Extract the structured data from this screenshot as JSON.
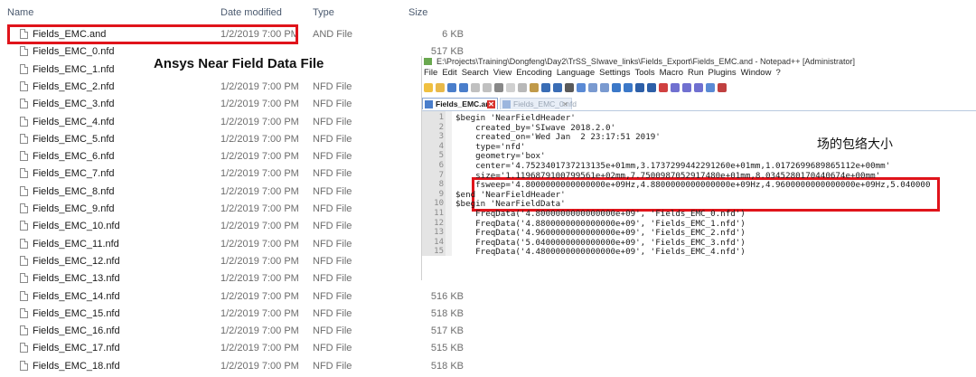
{
  "explorer": {
    "columns": {
      "name": "Name",
      "date": "Date modified",
      "type": "Type",
      "size": "Size"
    },
    "files": [
      {
        "name": "Fields_EMC.and",
        "date": "1/2/2019 7:00 PM",
        "type": "AND File",
        "size": "6 KB"
      },
      {
        "name": "Fields_EMC_0.nfd",
        "date": "",
        "type": "",
        "size": "517 KB"
      },
      {
        "name": "Fields_EMC_1.nfd",
        "date": "",
        "type": "",
        "size": ""
      },
      {
        "name": "Fields_EMC_2.nfd",
        "date": "1/2/2019 7:00 PM",
        "type": "NFD File",
        "size": ""
      },
      {
        "name": "Fields_EMC_3.nfd",
        "date": "1/2/2019 7:00 PM",
        "type": "NFD File",
        "size": ""
      },
      {
        "name": "Fields_EMC_4.nfd",
        "date": "1/2/2019 7:00 PM",
        "type": "NFD File",
        "size": ""
      },
      {
        "name": "Fields_EMC_5.nfd",
        "date": "1/2/2019 7:00 PM",
        "type": "NFD File",
        "size": ""
      },
      {
        "name": "Fields_EMC_6.nfd",
        "date": "1/2/2019 7:00 PM",
        "type": "NFD File",
        "size": ""
      },
      {
        "name": "Fields_EMC_7.nfd",
        "date": "1/2/2019 7:00 PM",
        "type": "NFD File",
        "size": ""
      },
      {
        "name": "Fields_EMC_8.nfd",
        "date": "1/2/2019 7:00 PM",
        "type": "NFD File",
        "size": ""
      },
      {
        "name": "Fields_EMC_9.nfd",
        "date": "1/2/2019 7:00 PM",
        "type": "NFD File",
        "size": ""
      },
      {
        "name": "Fields_EMC_10.nfd",
        "date": "1/2/2019 7:00 PM",
        "type": "NFD File",
        "size": ""
      },
      {
        "name": "Fields_EMC_11.nfd",
        "date": "1/2/2019 7:00 PM",
        "type": "NFD File",
        "size": ""
      },
      {
        "name": "Fields_EMC_12.nfd",
        "date": "1/2/2019 7:00 PM",
        "type": "NFD File",
        "size": ""
      },
      {
        "name": "Fields_EMC_13.nfd",
        "date": "1/2/2019 7:00 PM",
        "type": "NFD File",
        "size": ""
      },
      {
        "name": "Fields_EMC_14.nfd",
        "date": "1/2/2019 7:00 PM",
        "type": "NFD File",
        "size": "516 KB"
      },
      {
        "name": "Fields_EMC_15.nfd",
        "date": "1/2/2019 7:00 PM",
        "type": "NFD File",
        "size": "518 KB"
      },
      {
        "name": "Fields_EMC_16.nfd",
        "date": "1/2/2019 7:00 PM",
        "type": "NFD File",
        "size": "517 KB"
      },
      {
        "name": "Fields_EMC_17.nfd",
        "date": "1/2/2019 7:00 PM",
        "type": "NFD File",
        "size": "515 KB"
      },
      {
        "name": "Fields_EMC_18.nfd",
        "date": "1/2/2019 7:00 PM",
        "type": "NFD File",
        "size": "518 KB"
      }
    ]
  },
  "annotation_file": "Ansys Near Field Data File",
  "annotation_size": "场的包络大小",
  "notepad": {
    "title": "E:\\Projects\\Training\\Dongfeng\\Day2\\TrSS_SIwave_links\\Fields_Export\\Fields_EMC.and - Notepad++ [Administrator]",
    "menu": [
      "File",
      "Edit",
      "Search",
      "View",
      "Encoding",
      "Language",
      "Settings",
      "Tools",
      "Macro",
      "Run",
      "Plugins",
      "Window",
      "?"
    ],
    "tabs": [
      {
        "label": "Fields_EMC.and",
        "close": "✕"
      },
      {
        "label": "Fields_EMC_0.nfd",
        "close": "✕"
      }
    ],
    "lines": [
      {
        "n": "1",
        "text": "$begin 'NearFieldHeader'"
      },
      {
        "n": "2",
        "text": "    created_by='SIwave 2018.2.0'"
      },
      {
        "n": "3",
        "text": "    created_on='Wed Jan  2 23:17:51 2019'"
      },
      {
        "n": "4",
        "text": "    type='nfd'"
      },
      {
        "n": "5",
        "text": "    geometry='box'"
      },
      {
        "n": "6",
        "text": "    center='4.7523401737213135e+01mm,3.1737299442291260e+01mm,1.0172699689865112e+00mm'"
      },
      {
        "n": "7",
        "text": "    size='1.1196879100799561e+02mm,7.7500987052917480e+01mm,8.0345280170440674e+00mm'"
      },
      {
        "n": "8",
        "text": "    fsweep='4.8000000000000000e+09Hz,4.8800000000000000e+09Hz,4.9600000000000000e+09Hz,5.040000"
      },
      {
        "n": "9",
        "text": "$end 'NearFieldHeader'"
      },
      {
        "n": "10",
        "text": "$begin 'NearFieldData'"
      },
      {
        "n": "11",
        "text": "    FreqData('4.8000000000000000e+09', 'Fields_EMC_0.nfd')"
      },
      {
        "n": "12",
        "text": "    FreqData('4.8800000000000000e+09', 'Fields_EMC_1.nfd')"
      },
      {
        "n": "13",
        "text": "    FreqData('4.9600000000000000e+09', 'Fields_EMC_2.nfd')"
      },
      {
        "n": "14",
        "text": "    FreqData('5.0400000000000000e+09', 'Fields_EMC_3.nfd')"
      },
      {
        "n": "15",
        "text": "    FreqData('4.4800000000000000e+09', 'Fields_EMC_4.nfd')"
      }
    ]
  }
}
